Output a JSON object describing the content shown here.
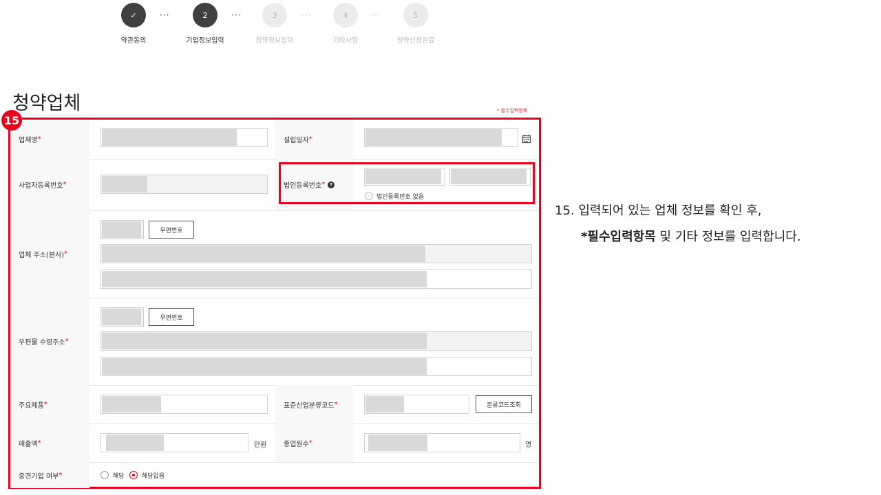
{
  "stepper": {
    "steps": [
      {
        "number": "✓",
        "label": "약관동의",
        "state": "done"
      },
      {
        "number": "2",
        "label": "기업정보입력",
        "state": "active"
      },
      {
        "number": "3",
        "label": "청약정보입력",
        "state": "pending"
      },
      {
        "number": "4",
        "label": "기타사항",
        "state": "pending"
      },
      {
        "number": "5",
        "label": "청약신청완료",
        "state": "pending"
      }
    ],
    "separator": "···"
  },
  "section": {
    "title": "청약업체",
    "required_note": "* 필수입력항목",
    "badge": "15"
  },
  "form": {
    "required_mark": "*",
    "company_name": {
      "label": "업체명"
    },
    "established_date": {
      "label": "설립일자"
    },
    "business_reg_no": {
      "label": "사업자등록번호"
    },
    "corp_reg_no": {
      "label": "법인등록번호",
      "help": "?",
      "none_option": "법인등록번호 없음"
    },
    "hq_address": {
      "label": "업체 주소(본사)",
      "postcode_button": "우편번호"
    },
    "mail_address": {
      "label": "우편물 수령주소",
      "postcode_button": "우편번호"
    },
    "main_products": {
      "label": "주요제품"
    },
    "industry_code": {
      "label": "표준산업분류코드",
      "lookup_button": "분류코드조회"
    },
    "revenue": {
      "label": "매출액",
      "unit": "만원"
    },
    "employees": {
      "label": "종업원수",
      "unit": "명"
    },
    "midsize": {
      "label": "중견기업 여부",
      "options": [
        "해당",
        "해당없음"
      ],
      "selected": "해당없음"
    }
  },
  "instruction": {
    "line1": "15. 입력되어 있는 업체 정보를 확인 후,",
    "line2_bold": "*필수입력항목",
    "line2_rest": " 및 기타 정보를 입력합니다."
  },
  "colors": {
    "accent": "#e8001c",
    "step_active": "#404040",
    "step_pending": "#ececec"
  }
}
